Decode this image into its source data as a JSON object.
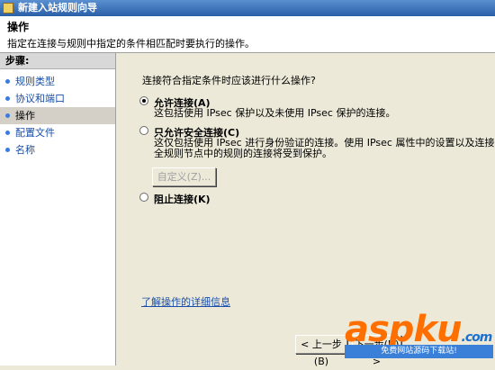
{
  "window": {
    "title": "新建入站规则向导"
  },
  "header": {
    "title": "操作",
    "description": "指定在连接与规则中指定的条件相匹配时要执行的操作。"
  },
  "steps": {
    "heading": "步骤:",
    "items": [
      {
        "label": "规则类型",
        "active": false
      },
      {
        "label": "协议和端口",
        "active": false
      },
      {
        "label": "操作",
        "active": true
      },
      {
        "label": "配置文件",
        "active": false
      },
      {
        "label": "名称",
        "active": false
      }
    ]
  },
  "main": {
    "question": "连接符合指定条件时应该进行什么操作?",
    "options": [
      {
        "label": "允许连接(A)",
        "desc_lines": [
          "这包括使用 IPsec 保护以及未使用 IPsec 保护的连接。"
        ],
        "checked": true
      },
      {
        "label": "只允许安全连接(C)",
        "desc_lines": [
          "这仅包括使用 IPsec 进行身份验证的连接。使用 IPsec 属性中的设置以及连接安",
          "全规则节点中的规则的连接将受到保护。"
        ],
        "checked": false
      },
      {
        "label": "阻止连接(K)",
        "desc_lines": [],
        "checked": false
      }
    ],
    "customize_button": "自定义(Z)...",
    "learn_more": "了解操作的详细信息"
  },
  "footer": {
    "back_button": "< 上一步(B)",
    "next_button": "下一步(N) >"
  },
  "watermark": {
    "logo": "aspku",
    "logo_suffix": ".com",
    "tagline": "免费网站源码下载站!"
  },
  "colors": {
    "link": "#1a4ea8",
    "titlebar": "#2a5fa8",
    "watermark_orange": "#ff6f00",
    "watermark_blue": "#1a6fd0"
  }
}
